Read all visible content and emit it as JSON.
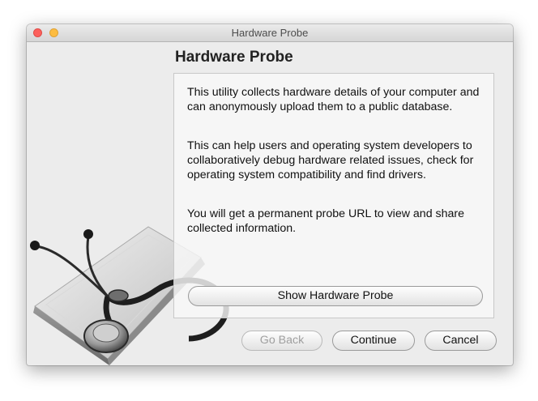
{
  "window": {
    "title": "Hardware Probe"
  },
  "header": {
    "heading": "Hardware Probe"
  },
  "content": {
    "paragraphs": [
      "This utility collects hardware details of your computer and can anonymously upload them to a public database.",
      "This can help users and operating system developers to collaboratively debug hardware related issues, check for operating system compatibility and find drivers.",
      "You will get a permanent probe URL to view and share collected information."
    ],
    "show_button_label": "Show Hardware Probe"
  },
  "footer": {
    "back_label": "Go Back",
    "back_enabled": false,
    "continue_label": "Continue",
    "cancel_label": "Cancel"
  },
  "icons": {
    "illustration": "stethoscope-on-computer-icon"
  },
  "colors": {
    "window_bg": "#ececec",
    "close": "#fc605c",
    "minimize": "#fdbc40"
  }
}
